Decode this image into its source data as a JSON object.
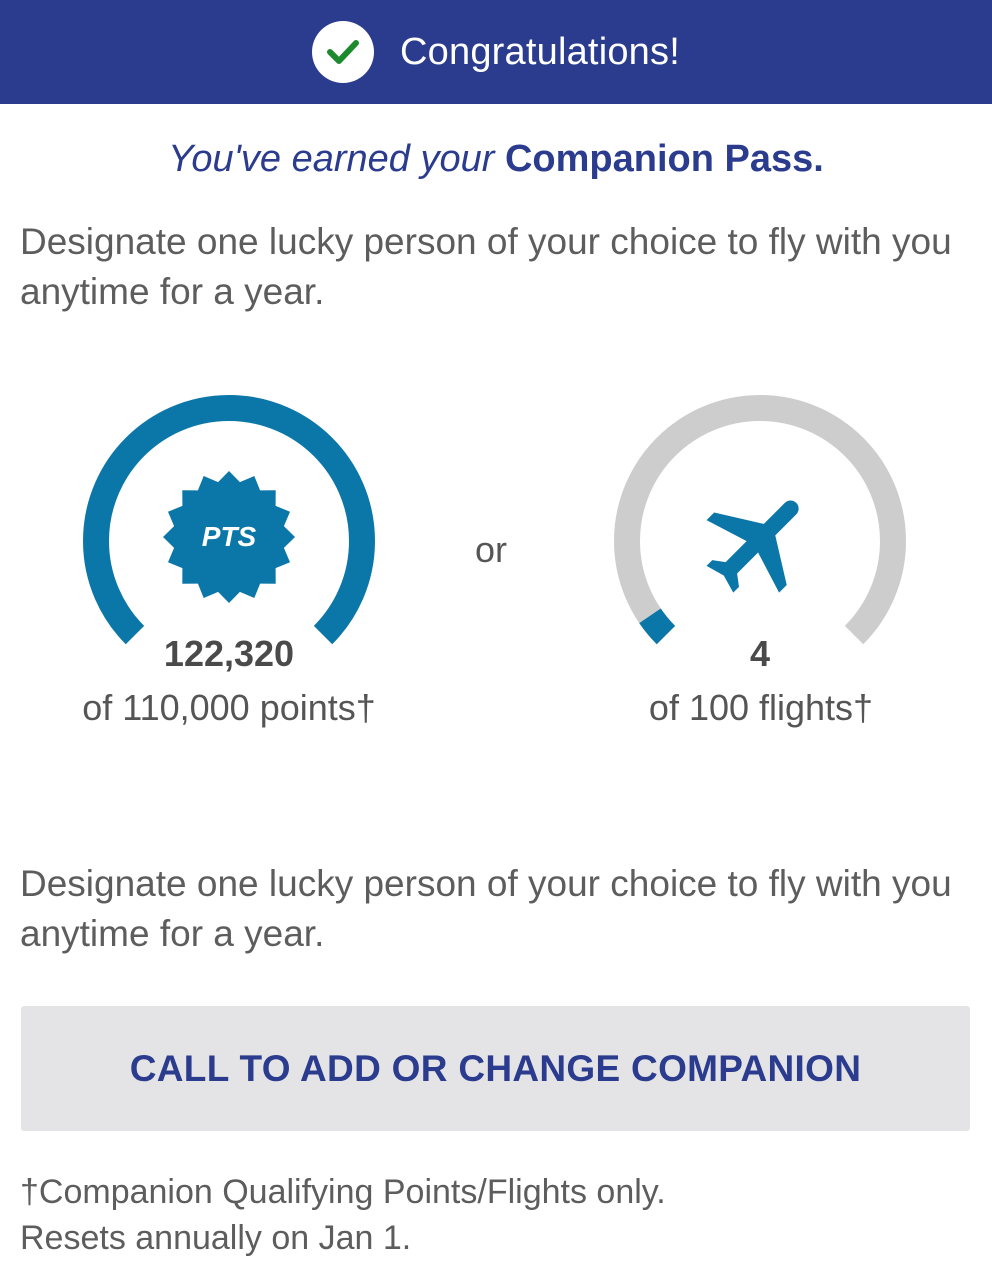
{
  "header": {
    "title": "Congratulations!",
    "icon": "checkmark-circle-icon",
    "background_color": "#2B3C8F",
    "check_color": "#1E8A2E"
  },
  "subtitle": {
    "lead": "You've earned your ",
    "highlight": "Companion Pass."
  },
  "description_top": "Designate one lucky person of your choice to fly with you anytime for a year.",
  "gauges": {
    "separator": "or",
    "points": {
      "badge_label": "PTS",
      "badge_icon": "pts-badge-icon",
      "value": "122,320",
      "caption": "of 110,000 points†",
      "current": 122320,
      "target": 110000,
      "progress": 1.0,
      "color": "#0B77A8"
    },
    "flights": {
      "icon": "airplane-icon",
      "value": "4",
      "caption": "of 100 flights†",
      "current": 4,
      "target": 100,
      "progress": 0.04,
      "color": "#0B77A8",
      "track_color": "#CDCDCD"
    }
  },
  "description_bottom": "Designate one lucky person of your choice to fly with you anytime for a year.",
  "cta": {
    "label": "CALL TO ADD OR CHANGE COMPANION"
  },
  "footnote": {
    "line1": "†Companion Qualifying Points/Flights only.",
    "line2": "Resets annually on Jan 1."
  }
}
